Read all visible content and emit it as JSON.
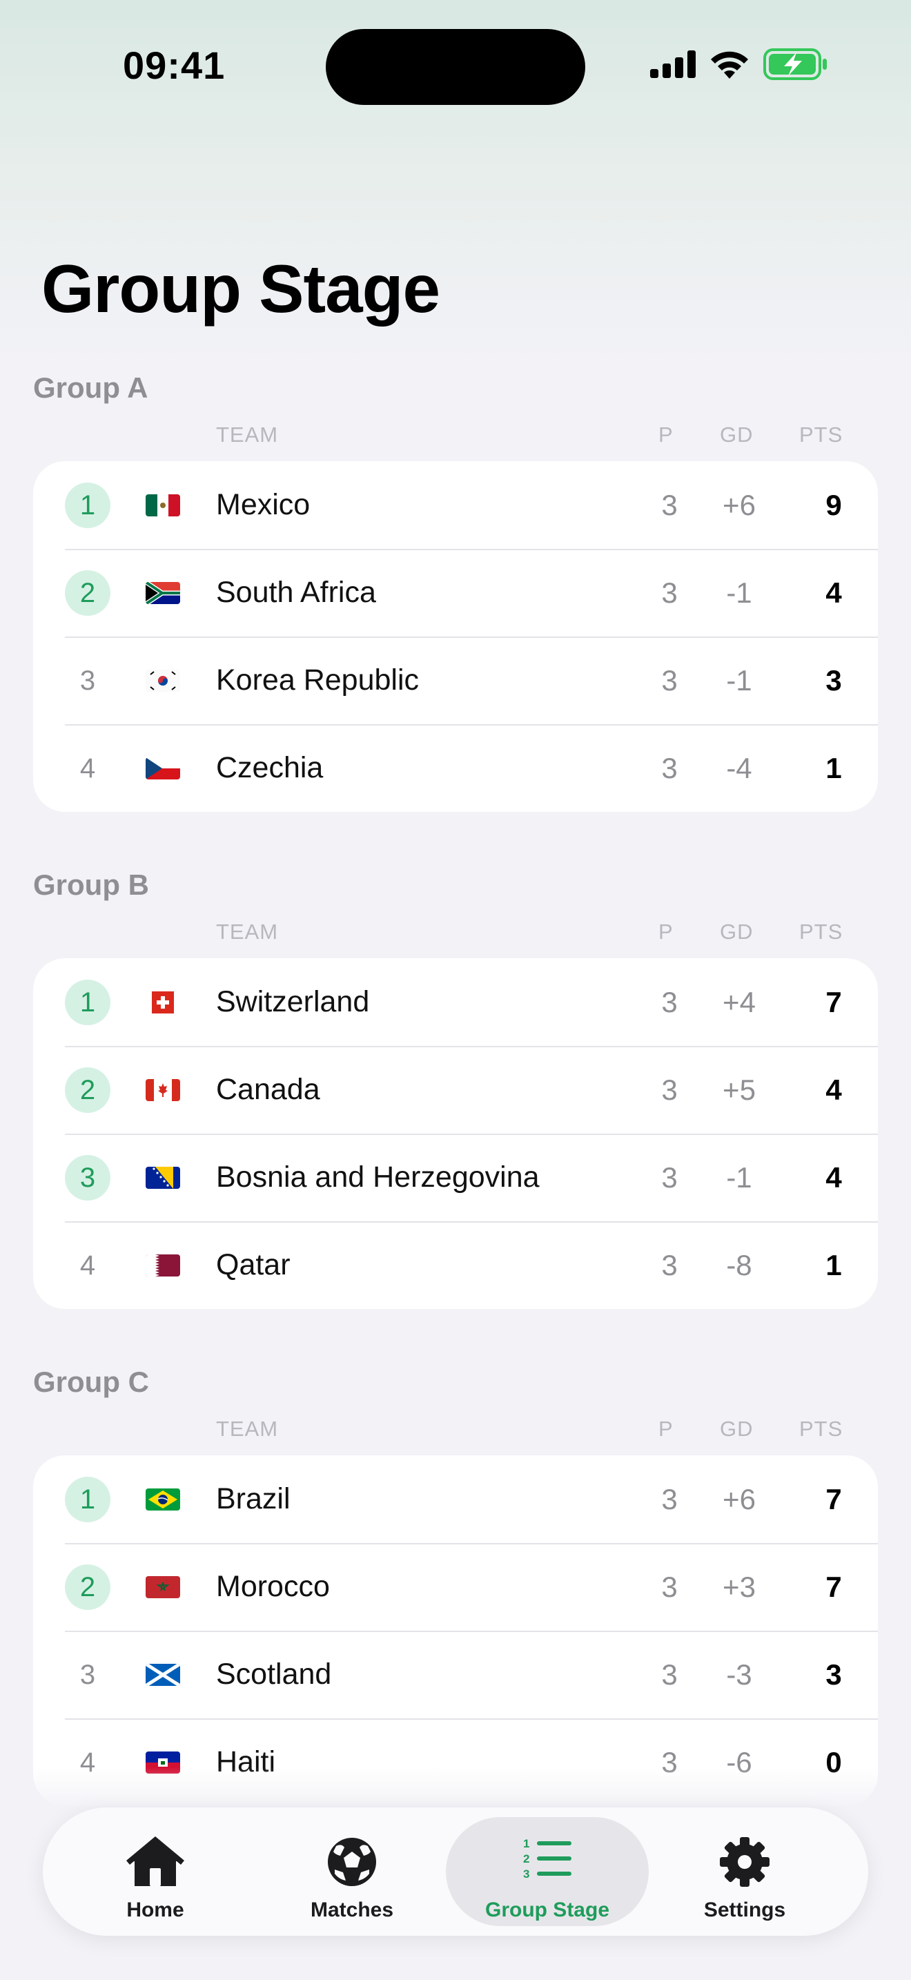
{
  "status_bar": {
    "time": "09:41"
  },
  "page_title": "Group Stage",
  "columns": {
    "team": "TEAM",
    "played": "P",
    "goal_diff": "GD",
    "points": "PTS"
  },
  "groups": [
    {
      "title": "Group A",
      "rows": [
        {
          "rank": "1",
          "team": "Mexico",
          "p": "3",
          "gd": "+6",
          "pts": "9",
          "flag": "mexico-flag"
        },
        {
          "rank": "2",
          "team": "South Africa",
          "p": "3",
          "gd": "-1",
          "pts": "4",
          "flag": "south-africa-flag"
        },
        {
          "rank": "3",
          "team": "Korea Republic",
          "p": "3",
          "gd": "-1",
          "pts": "3",
          "flag": "korea-flag"
        },
        {
          "rank": "4",
          "team": "Czechia",
          "p": "3",
          "gd": "-4",
          "pts": "1",
          "flag": "czechia-flag"
        }
      ]
    },
    {
      "title": "Group B",
      "rows": [
        {
          "rank": "1",
          "team": "Switzerland",
          "p": "3",
          "gd": "+4",
          "pts": "7",
          "flag": "switzerland-flag"
        },
        {
          "rank": "2",
          "team": "Canada",
          "p": "3",
          "gd": "+5",
          "pts": "4",
          "flag": "canada-flag"
        },
        {
          "rank": "3",
          "team": "Bosnia and Herzegovina",
          "p": "3",
          "gd": "-1",
          "pts": "4",
          "flag": "bosnia-flag"
        },
        {
          "rank": "4",
          "team": "Qatar",
          "p": "3",
          "gd": "-8",
          "pts": "1",
          "flag": "qatar-flag"
        }
      ]
    },
    {
      "title": "Group C",
      "rows": [
        {
          "rank": "1",
          "team": "Brazil",
          "p": "3",
          "gd": "+6",
          "pts": "7",
          "flag": "brazil-flag"
        },
        {
          "rank": "2",
          "team": "Morocco",
          "p": "3",
          "gd": "+3",
          "pts": "7",
          "flag": "morocco-flag"
        },
        {
          "rank": "3",
          "team": "Scotland",
          "p": "3",
          "gd": "-3",
          "pts": "3",
          "flag": "scotland-flag"
        },
        {
          "rank": "4",
          "team": "Haiti",
          "p": "3",
          "gd": "-6",
          "pts": "0",
          "flag": "haiti-flag"
        }
      ]
    }
  ],
  "tab_bar": {
    "items": [
      {
        "label": "Home",
        "icon": "home-icon"
      },
      {
        "label": "Matches",
        "icon": "soccer-ball-icon"
      },
      {
        "label": "Group Stage",
        "icon": "numbered-list-icon",
        "active": true
      },
      {
        "label": "Settings",
        "icon": "gear-icon"
      }
    ]
  },
  "colors": {
    "accent": "#1f9c5b",
    "qualified_badge": "#d5f1e4"
  }
}
